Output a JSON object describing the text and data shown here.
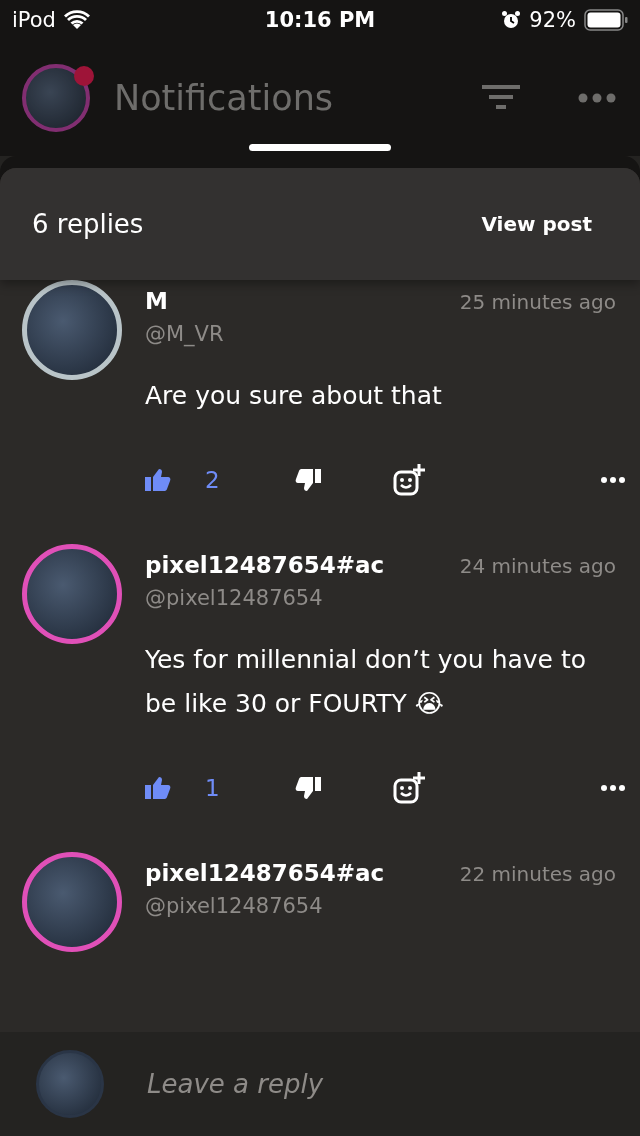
{
  "status_bar": {
    "carrier": "iPod",
    "time": "10:16 PM",
    "battery": "92%"
  },
  "header": {
    "title": "Notifications"
  },
  "sheet": {
    "count": "6 replies",
    "view_post": "View post"
  },
  "comments": [
    {
      "name": "M",
      "handle": "@M_VR",
      "time": "25 minutes ago",
      "body": "Are you sure about that",
      "likes": "2",
      "liked": true,
      "color": "#b9c4c8"
    },
    {
      "name": "pixel12487654#ac",
      "handle": "@pixel12487654",
      "time": "24 minutes ago",
      "body": "Yes for millennial don’t you have to be like 30 or FOURTY 😭",
      "likes": "1",
      "liked": true,
      "color": "#e050b8"
    },
    {
      "name": "pixel12487654#ac",
      "handle": "@pixel12487654",
      "time": "22 minutes ago",
      "color": "#e050b8"
    }
  ],
  "reply": {
    "placeholder": "Leave a reply"
  }
}
